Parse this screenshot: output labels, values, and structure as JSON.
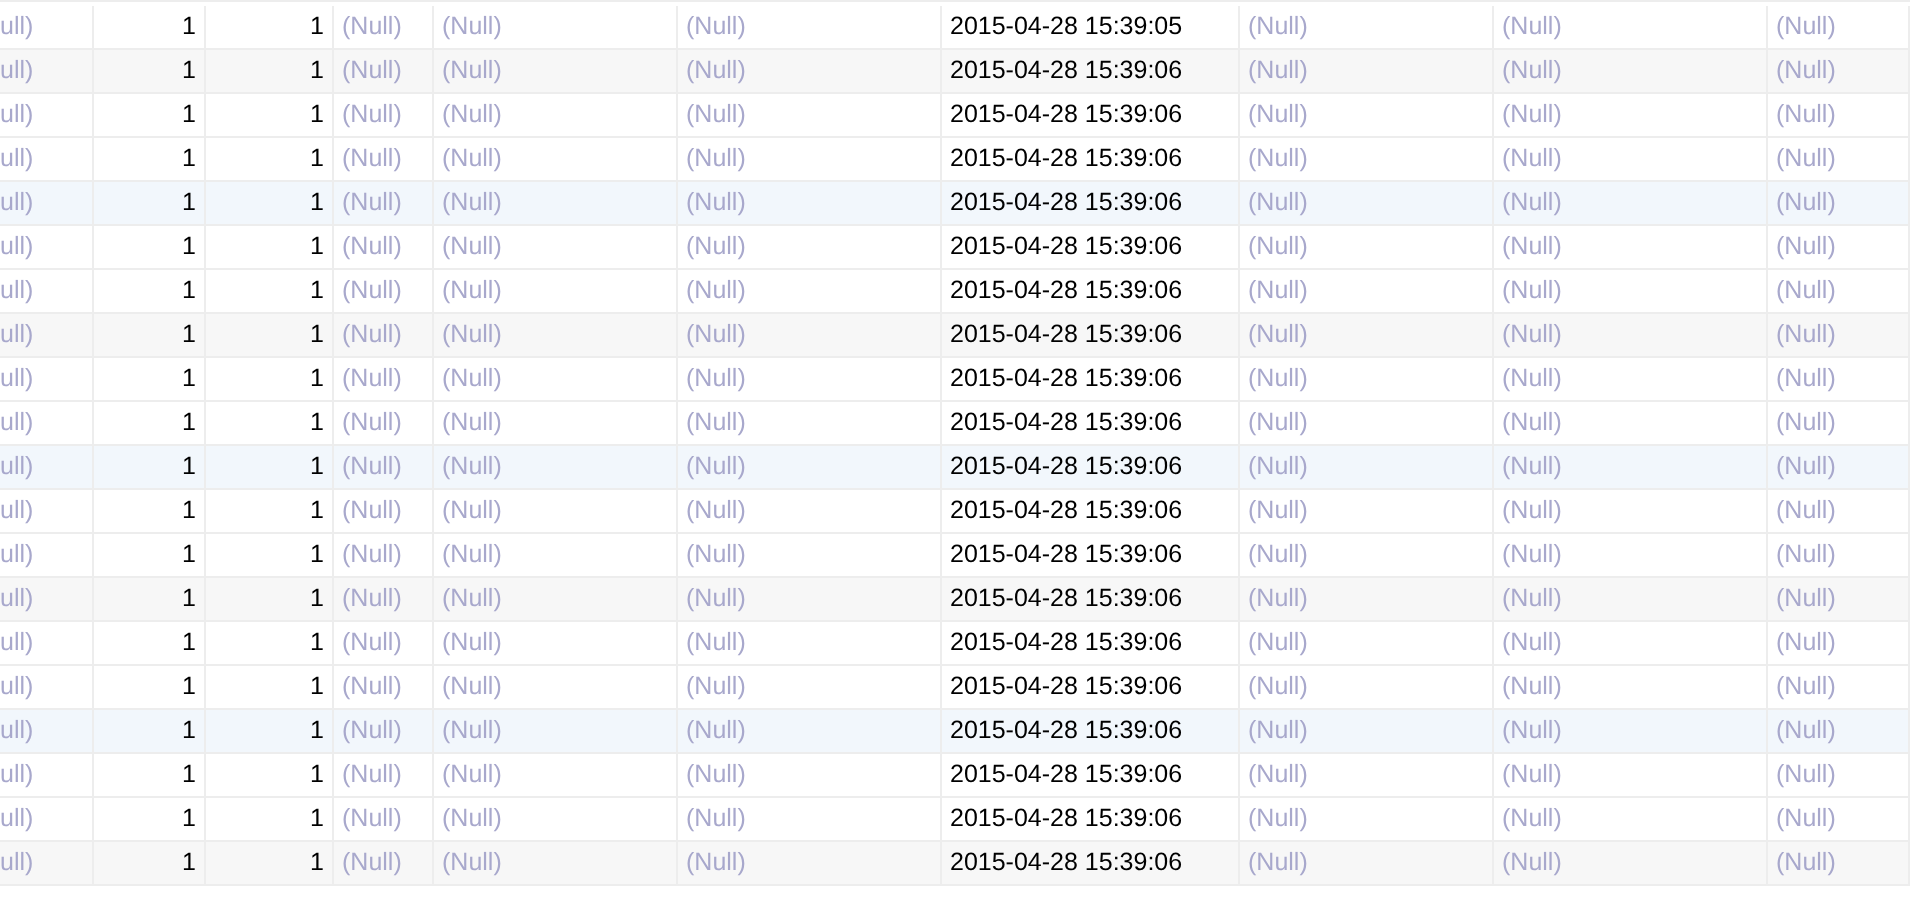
{
  "grid": {
    "columns": [
      {
        "kind": "null"
      },
      {
        "kind": "number"
      },
      {
        "kind": "number"
      },
      {
        "kind": "null"
      },
      {
        "kind": "null"
      },
      {
        "kind": "null"
      },
      {
        "kind": "datetime"
      },
      {
        "kind": "null"
      },
      {
        "kind": "null"
      },
      {
        "kind": "null"
      }
    ],
    "rows": [
      {
        "kind": "plain",
        "cells": [
          "ull)",
          "1",
          "1",
          "(Null)",
          "(Null)",
          "(Null)",
          "2015-04-28 15:39:05",
          "(Null)",
          "(Null)",
          "(Null)"
        ]
      },
      {
        "kind": "shaded",
        "cells": [
          "ull)",
          "1",
          "1",
          "(Null)",
          "(Null)",
          "(Null)",
          "2015-04-28 15:39:06",
          "(Null)",
          "(Null)",
          "(Null)"
        ]
      },
      {
        "kind": "plain",
        "cells": [
          "ull)",
          "1",
          "1",
          "(Null)",
          "(Null)",
          "(Null)",
          "2015-04-28 15:39:06",
          "(Null)",
          "(Null)",
          "(Null)"
        ]
      },
      {
        "kind": "plain",
        "cells": [
          "ull)",
          "1",
          "1",
          "(Null)",
          "(Null)",
          "(Null)",
          "2015-04-28 15:39:06",
          "(Null)",
          "(Null)",
          "(Null)"
        ]
      },
      {
        "kind": "tinted",
        "cells": [
          "ull)",
          "1",
          "1",
          "(Null)",
          "(Null)",
          "(Null)",
          "2015-04-28 15:39:06",
          "(Null)",
          "(Null)",
          "(Null)"
        ]
      },
      {
        "kind": "plain",
        "cells": [
          "ull)",
          "1",
          "1",
          "(Null)",
          "(Null)",
          "(Null)",
          "2015-04-28 15:39:06",
          "(Null)",
          "(Null)",
          "(Null)"
        ]
      },
      {
        "kind": "plain",
        "cells": [
          "ull)",
          "1",
          "1",
          "(Null)",
          "(Null)",
          "(Null)",
          "2015-04-28 15:39:06",
          "(Null)",
          "(Null)",
          "(Null)"
        ]
      },
      {
        "kind": "shaded",
        "cells": [
          "ull)",
          "1",
          "1",
          "(Null)",
          "(Null)",
          "(Null)",
          "2015-04-28 15:39:06",
          "(Null)",
          "(Null)",
          "(Null)"
        ]
      },
      {
        "kind": "plain",
        "cells": [
          "ull)",
          "1",
          "1",
          "(Null)",
          "(Null)",
          "(Null)",
          "2015-04-28 15:39:06",
          "(Null)",
          "(Null)",
          "(Null)"
        ]
      },
      {
        "kind": "plain",
        "cells": [
          "ull)",
          "1",
          "1",
          "(Null)",
          "(Null)",
          "(Null)",
          "2015-04-28 15:39:06",
          "(Null)",
          "(Null)",
          "(Null)"
        ]
      },
      {
        "kind": "tinted",
        "cells": [
          "ull)",
          "1",
          "1",
          "(Null)",
          "(Null)",
          "(Null)",
          "2015-04-28 15:39:06",
          "(Null)",
          "(Null)",
          "(Null)"
        ]
      },
      {
        "kind": "plain",
        "cells": [
          "ull)",
          "1",
          "1",
          "(Null)",
          "(Null)",
          "(Null)",
          "2015-04-28 15:39:06",
          "(Null)",
          "(Null)",
          "(Null)"
        ]
      },
      {
        "kind": "plain",
        "cells": [
          "ull)",
          "1",
          "1",
          "(Null)",
          "(Null)",
          "(Null)",
          "2015-04-28 15:39:06",
          "(Null)",
          "(Null)",
          "(Null)"
        ]
      },
      {
        "kind": "shaded",
        "cells": [
          "ull)",
          "1",
          "1",
          "(Null)",
          "(Null)",
          "(Null)",
          "2015-04-28 15:39:06",
          "(Null)",
          "(Null)",
          "(Null)"
        ]
      },
      {
        "kind": "plain",
        "cells": [
          "ull)",
          "1",
          "1",
          "(Null)",
          "(Null)",
          "(Null)",
          "2015-04-28 15:39:06",
          "(Null)",
          "(Null)",
          "(Null)"
        ]
      },
      {
        "kind": "plain",
        "cells": [
          "ull)",
          "1",
          "1",
          "(Null)",
          "(Null)",
          "(Null)",
          "2015-04-28 15:39:06",
          "(Null)",
          "(Null)",
          "(Null)"
        ]
      },
      {
        "kind": "tinted",
        "cells": [
          "ull)",
          "1",
          "1",
          "(Null)",
          "(Null)",
          "(Null)",
          "2015-04-28 15:39:06",
          "(Null)",
          "(Null)",
          "(Null)"
        ]
      },
      {
        "kind": "plain",
        "cells": [
          "ull)",
          "1",
          "1",
          "(Null)",
          "(Null)",
          "(Null)",
          "2015-04-28 15:39:06",
          "(Null)",
          "(Null)",
          "(Null)"
        ]
      },
      {
        "kind": "plain",
        "cells": [
          "ull)",
          "1",
          "1",
          "(Null)",
          "(Null)",
          "(Null)",
          "2015-04-28 15:39:06",
          "(Null)",
          "(Null)",
          "(Null)"
        ]
      },
      {
        "kind": "shaded",
        "cells": [
          "ull)",
          "1",
          "1",
          "(Null)",
          "(Null)",
          "(Null)",
          "2015-04-28 15:39:06",
          "(Null)",
          "(Null)",
          "(Null)"
        ]
      }
    ]
  }
}
